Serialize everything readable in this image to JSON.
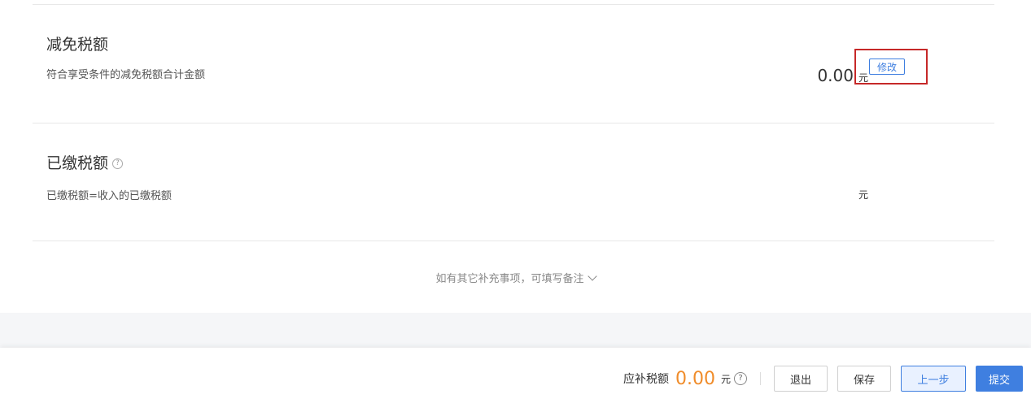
{
  "tax_reduction": {
    "title": "减免税额",
    "description": "符合享受条件的减免税额合计金额",
    "amount": "0.00",
    "unit": "元",
    "edit_label": "修改"
  },
  "tax_paid": {
    "title": "已缴税额",
    "help_icon": "?",
    "description": "已缴税额=收入的已缴税额",
    "unit": "元"
  },
  "remark": {
    "label": "如有其它补充事项，可填写备注"
  },
  "footer": {
    "due_label": "应补税额",
    "due_amount": "0.00",
    "due_unit": "元",
    "help_icon": "?",
    "exit_label": "退出",
    "save_label": "保存",
    "prev_label": "上一步",
    "submit_label": "提交"
  },
  "colors": {
    "accent": "#3f7fe0",
    "amount_due": "#f08c2a",
    "highlight_border": "#c62828"
  }
}
